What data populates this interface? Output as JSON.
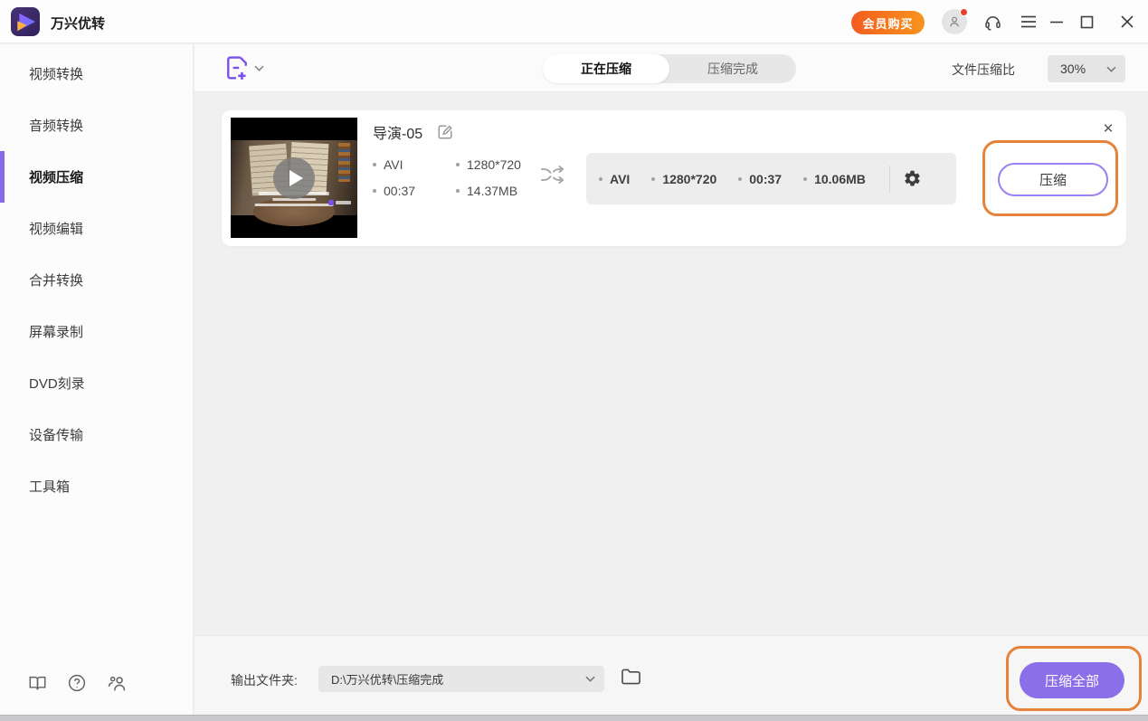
{
  "titlebar": {
    "app_name": "万兴优转",
    "membership_button": "会员购买"
  },
  "sidebar": {
    "items": [
      {
        "label": "视频转换",
        "active": false
      },
      {
        "label": "音频转换",
        "active": false
      },
      {
        "label": "视频压缩",
        "active": true
      },
      {
        "label": "视频编辑",
        "active": false
      },
      {
        "label": "合并转换",
        "active": false
      },
      {
        "label": "屏幕录制",
        "active": false
      },
      {
        "label": "DVD刻录",
        "active": false
      },
      {
        "label": "设备传输",
        "active": false
      },
      {
        "label": "工具箱",
        "active": false
      }
    ]
  },
  "toolbar": {
    "tabs": [
      {
        "label": "正在压缩",
        "active": true
      },
      {
        "label": "压缩完成",
        "active": false
      }
    ],
    "compression_ratio_label": "文件压缩比",
    "compression_ratio_value": "30%"
  },
  "card": {
    "title": "导演-05",
    "source_items": [
      "AVI",
      "1280*720",
      "00:37",
      "14.37MB"
    ],
    "output_items": [
      "AVI",
      "1280*720",
      "00:37",
      "10.06MB"
    ],
    "compress_button": "压缩"
  },
  "footer": {
    "output_folder_label": "输出文件夹:",
    "output_folder_path": "D:\\万兴优转\\压缩完成",
    "compress_all_button": "压缩全部"
  },
  "icons": {
    "close": "✕"
  },
  "colors": {
    "accent_purple": "#8b6fe8",
    "accent_orange": "#e5823b",
    "membership_orange": "#f3641e",
    "notification_red": "#e8402e"
  }
}
